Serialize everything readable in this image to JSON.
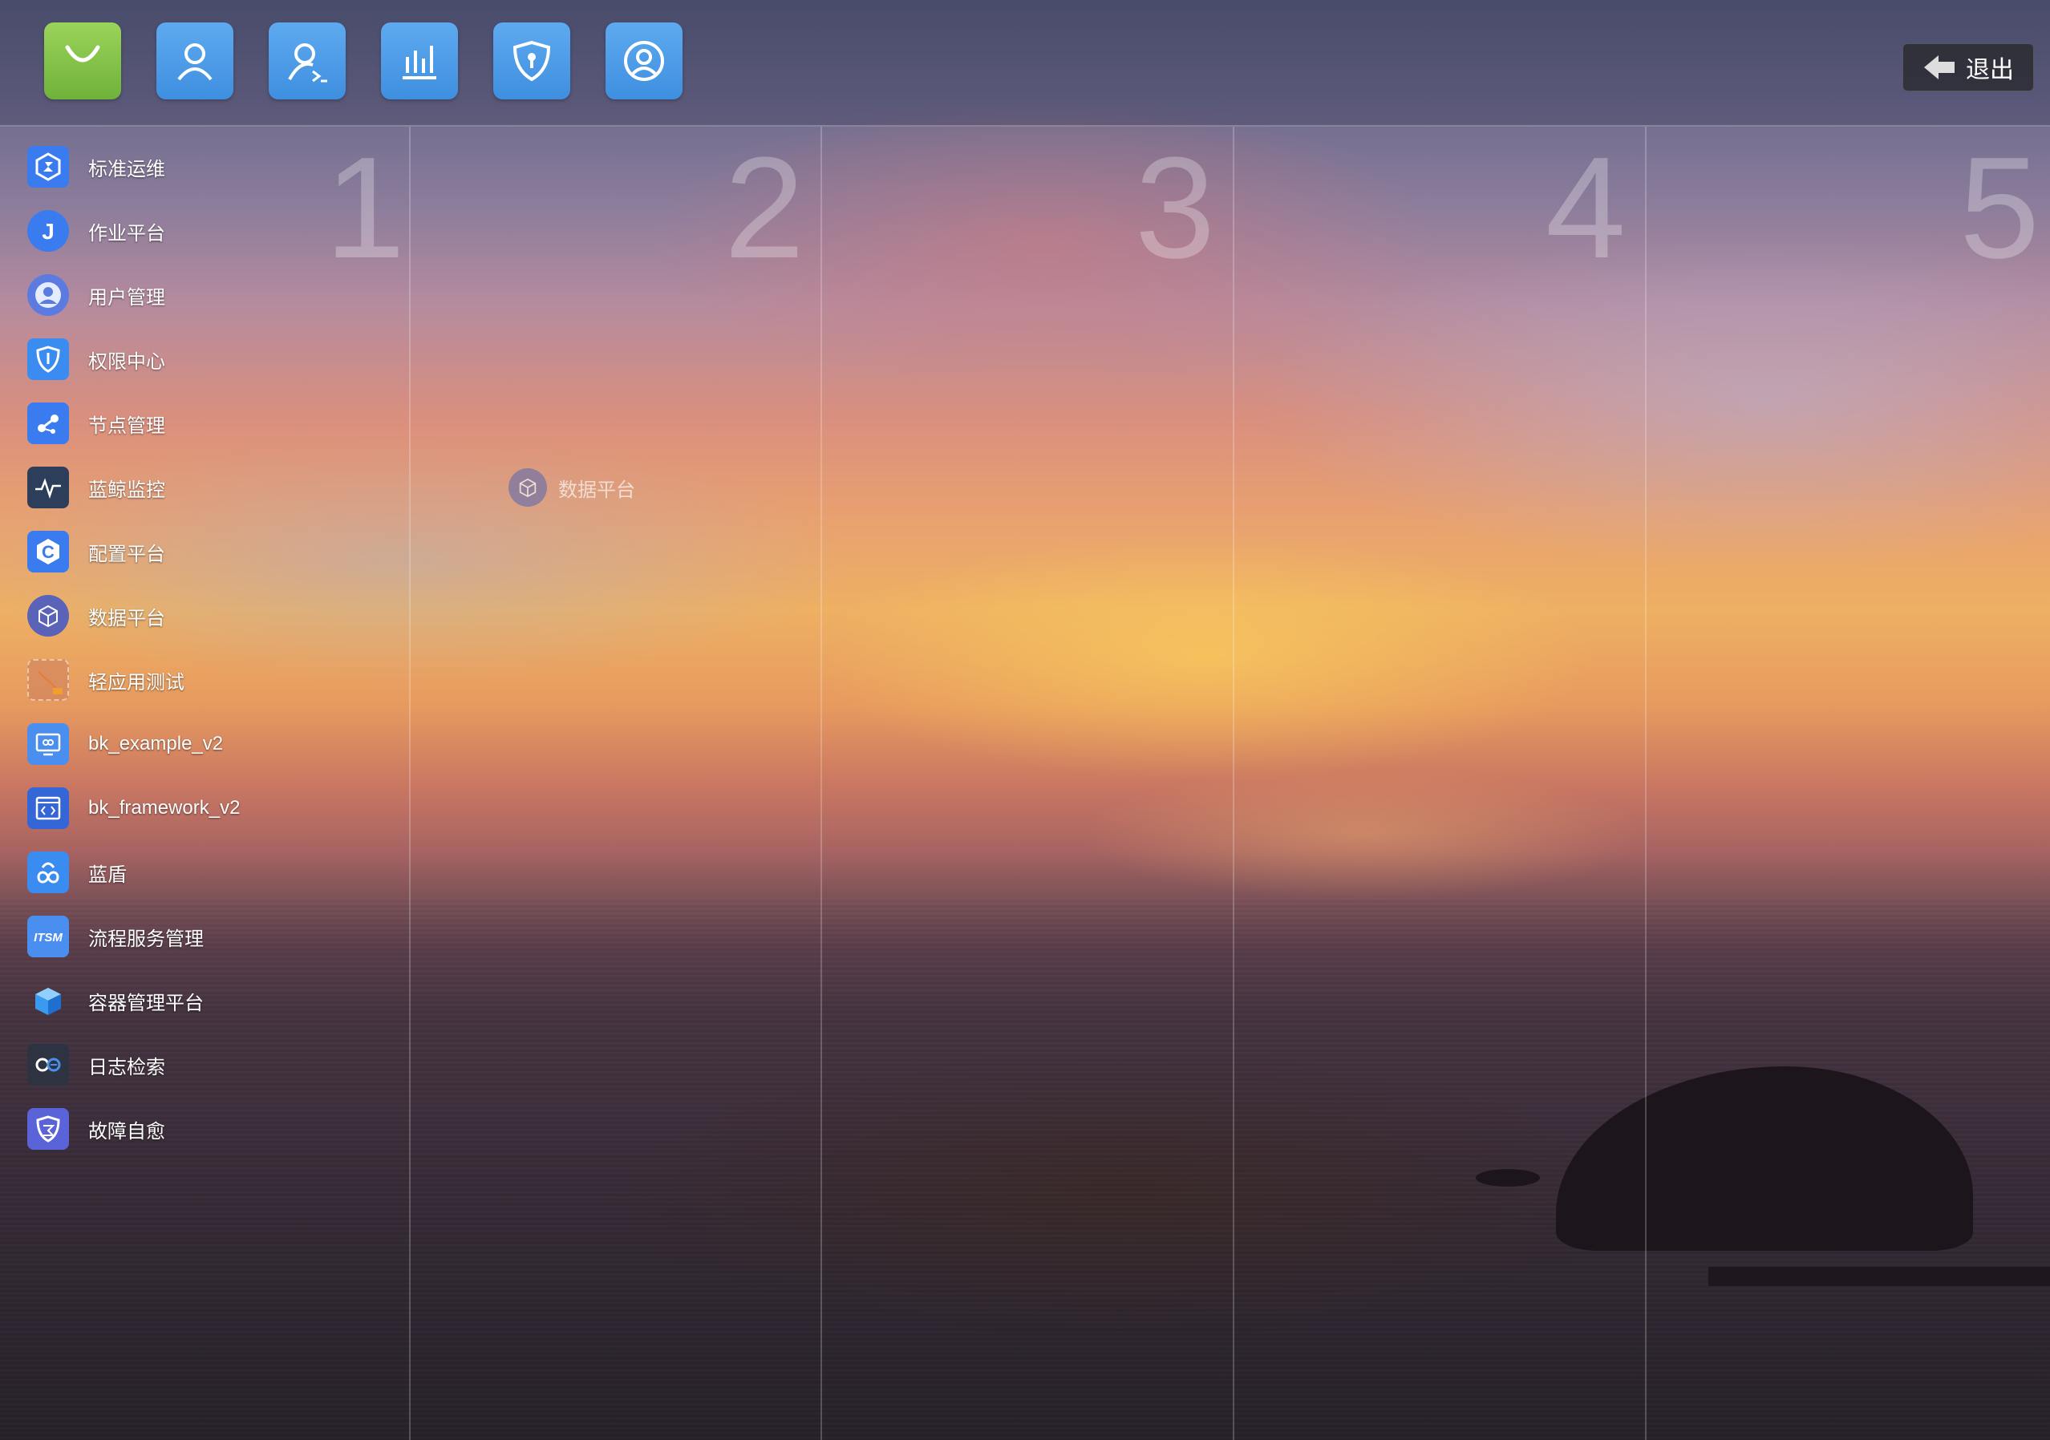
{
  "dock": {
    "icons": [
      {
        "name": "app-market-icon",
        "color": "#8ac64a"
      },
      {
        "name": "user-icon",
        "color": "#4f9fe6"
      },
      {
        "name": "user-settings-icon",
        "color": "#4f9fe6"
      },
      {
        "name": "chart-icon",
        "color": "#4f9fe6"
      },
      {
        "name": "shield-icon",
        "color": "#4f9fe6"
      },
      {
        "name": "user-circle-icon",
        "color": "#4f9fe6"
      }
    ],
    "logout_label": "退出"
  },
  "desktops": [
    "1",
    "2",
    "3",
    "4",
    "5"
  ],
  "apps": [
    {
      "label": "标准运维",
      "icon": "gear-hex-icon",
      "color": "#3a7bf0"
    },
    {
      "label": "作业平台",
      "icon": "letter-j-icon",
      "color": "#3a7bf0"
    },
    {
      "label": "用户管理",
      "icon": "user-circle-icon",
      "color": "#5b7be0"
    },
    {
      "label": "权限中心",
      "icon": "shield-icon",
      "color": "#3a8cf0"
    },
    {
      "label": "节点管理",
      "icon": "nodes-icon",
      "color": "#3a7bf0"
    },
    {
      "label": "蓝鲸监控",
      "icon": "pulse-icon",
      "color": "#2d3e5a"
    },
    {
      "label": "配置平台",
      "icon": "letter-c-icon",
      "color": "#3a7bf0"
    },
    {
      "label": "数据平台",
      "icon": "cube-icon",
      "color": "#5b63b8"
    },
    {
      "label": "轻应用测试",
      "icon": "light-app-icon",
      "color": "#c97a5a"
    },
    {
      "label": "bk_example_v2",
      "icon": "monitor-icon",
      "color": "#4a8ff0"
    },
    {
      "label": "bk_framework_v2",
      "icon": "code-window-icon",
      "color": "#3466d8"
    },
    {
      "label": "蓝盾",
      "icon": "infinity-cloud-icon",
      "color": "#3a8cf0"
    },
    {
      "label": "流程服务管理",
      "icon": "itsm-icon",
      "color": "#4a8ff0"
    },
    {
      "label": "容器管理平台",
      "icon": "box-3d-icon",
      "color": "#3aa0f0"
    },
    {
      "label": "日志检索",
      "icon": "log-search-icon",
      "color": "#2d3340"
    },
    {
      "label": "故障自愈",
      "icon": "shield-heal-icon",
      "color": "#5b63d8"
    }
  ],
  "desktop_app": {
    "label": "数据平台",
    "icon": "cube-icon"
  }
}
